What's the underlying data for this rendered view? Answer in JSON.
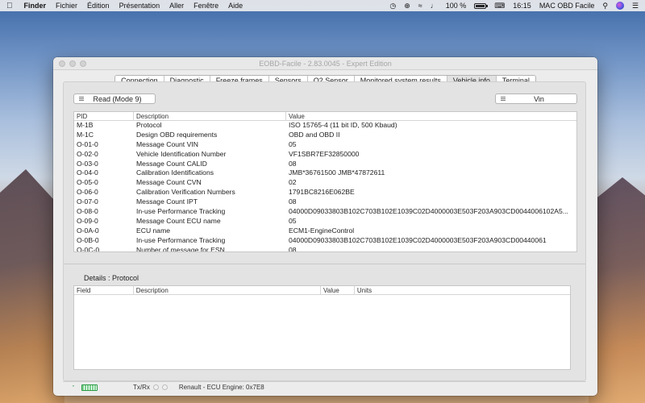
{
  "menubar": {
    "app": "Finder",
    "items": [
      "Fichier",
      "Édition",
      "Présentation",
      "Aller",
      "Fenêtre",
      "Aide"
    ],
    "battery": "100 %",
    "battery_level": 1.0,
    "time": "16:15",
    "user": "MAC OBD Facile"
  },
  "window": {
    "title": "EOBD-Facile - 2.83.0045 - Expert Edition",
    "tabs": [
      "Connection",
      "Diagnostic",
      "Freeze frames",
      "Sensors",
      "O2 Sensor",
      "Monitored system results",
      "Vehicle info",
      "Terminal"
    ],
    "active_tab": "Vehicle info"
  },
  "toolbar": {
    "read_label": "Read (Mode 9)",
    "vin_label": "Vin"
  },
  "pid_table": {
    "columns": [
      "PID",
      "Description",
      "Value"
    ],
    "rows": [
      [
        "M-1B",
        "Protocol",
        "ISO 15765-4 (11 bit ID, 500 Kbaud)"
      ],
      [
        "M-1C",
        "Design OBD requirements",
        "OBD and OBD II"
      ],
      [
        "O-01-0",
        "Message Count VIN",
        "05"
      ],
      [
        "O-02-0",
        "Vehicle Identification Number",
        "VF1SBR7EF32850000"
      ],
      [
        "O-03-0",
        "Message Count CALID",
        "08"
      ],
      [
        "O-04-0",
        "Calibration Identifications",
        "JMB*36761500    JMB*47872611"
      ],
      [
        "O-05-0",
        "Message Count CVN",
        "02"
      ],
      [
        "O-06-0",
        "Calibration Verification Numbers",
        "1791BC8216E062BE"
      ],
      [
        "O-07-0",
        "Message Count IPT",
        "08"
      ],
      [
        "O-08-0",
        "In-use Performance Tracking",
        "04000D09033803B102C703B102E1039C02D4000003E503F203A903CD0044006102A5..."
      ],
      [
        "O-09-0",
        "Message Count ECU name",
        "05"
      ],
      [
        "O-0A-0",
        "ECU name",
        "ECM1-EngineControl"
      ],
      [
        "O-0B-0",
        "In-use Performance Tracking",
        "04000D09033803B102C703B102E1039C02D4000003E503F203A903CD00440061"
      ],
      [
        "O-0C-0",
        "Number of message for ESN",
        "08"
      ]
    ]
  },
  "details": {
    "title": "Details : Protocol",
    "columns": [
      "Field",
      "Description",
      "Value",
      "Units"
    ]
  },
  "status": {
    "txrx_label": "Tx/Rx",
    "ecu_text": "Renault - ECU Engine: 0x7E8"
  }
}
